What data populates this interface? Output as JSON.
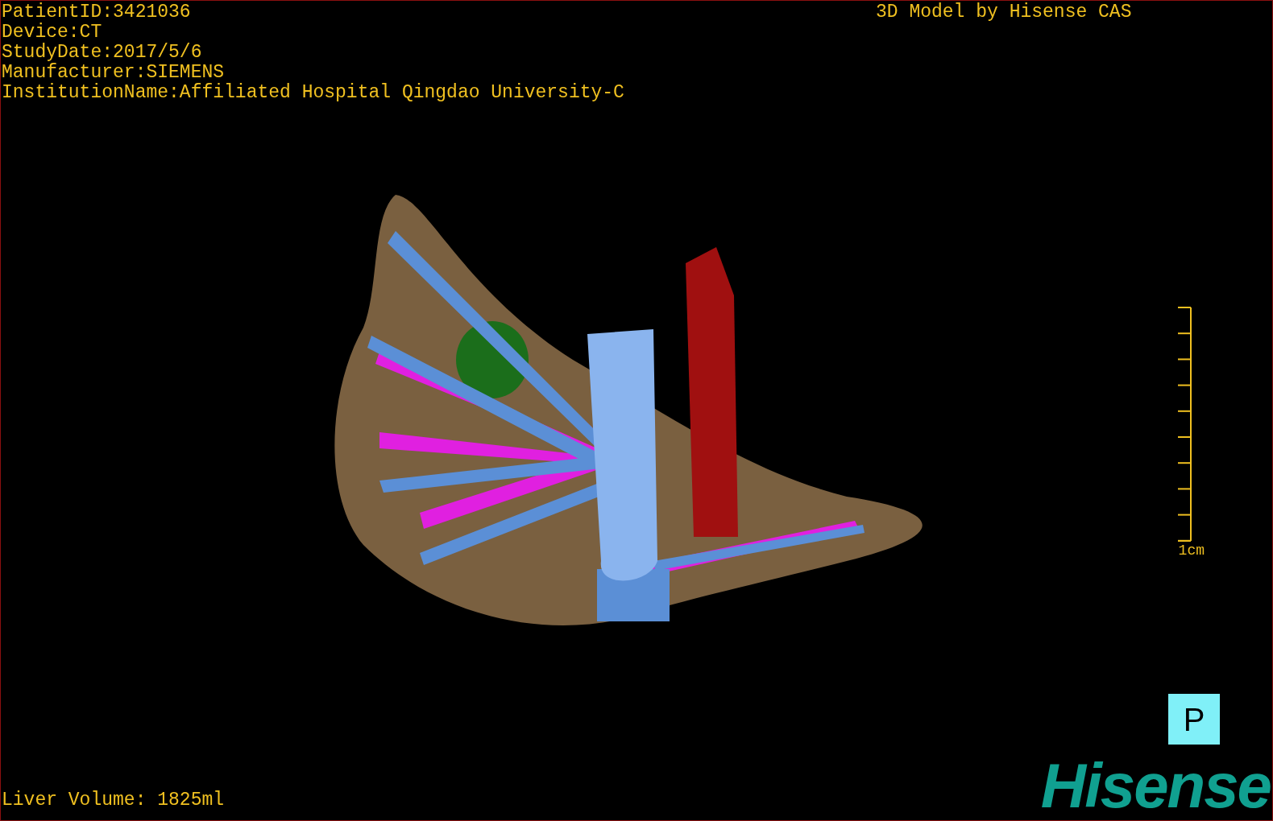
{
  "study_info": [
    "PatientID:3421036",
    "Device:CT",
    "StudyDate:2017/5/6",
    "Manufacturer:SIEMENS",
    "InstitutionName:Affiliated Hospital Qingdao University-C"
  ],
  "model_credit": "3D Model by Hisense CAS",
  "scale_bar": {
    "label": "1cm"
  },
  "orientation_marker": "P",
  "logo": "Hisense",
  "liver_volume": "Liver Volume: 1825ml"
}
